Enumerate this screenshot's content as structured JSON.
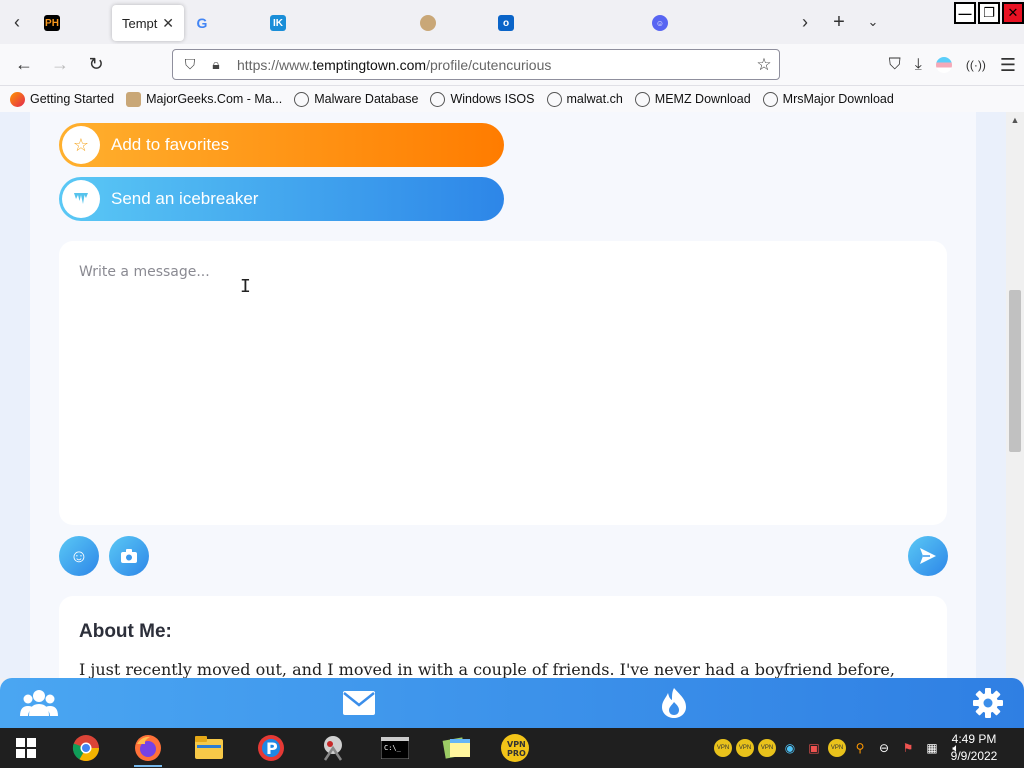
{
  "browser": {
    "tabs": [
      {
        "favicon_text": "PH",
        "title": "",
        "favicon_color": "#f7971d"
      },
      {
        "favicon_text": "",
        "title": "Temptin",
        "active": true
      },
      {
        "favicon_text": "G",
        "title": ""
      },
      {
        "favicon_text": "IK",
        "title": "",
        "favicon_color": "#1a8ed8"
      },
      {
        "favicon_text": "",
        "title": ""
      },
      {
        "favicon_text": "",
        "title": ""
      },
      {
        "favicon_text": "",
        "title": ""
      }
    ],
    "url": {
      "scheme": "https://www.",
      "host": "temptingtown.com",
      "path": "/profile/cutencurious"
    },
    "bookmarks": [
      "Getting Started",
      "MajorGeeks.Com - Ma...",
      "Malware Database",
      "Windows ISOS",
      "malwat.ch",
      "MEMZ Download",
      "MrsMajor Download"
    ]
  },
  "profile": {
    "favorites_label": "Add to favorites",
    "icebreaker_label": "Send an icebreaker",
    "message_placeholder": "Write a message...",
    "about_title": "About Me:",
    "about_text": "I just recently moved out, and I moved in with a couple of friends. I've never had a boyfriend before,"
  },
  "taskbar": {
    "time": "4:49 PM",
    "date": "9/9/2022"
  },
  "colors": {
    "favorites_gradient_start": "#ffb02e",
    "favorites_gradient_end": "#ff7c00",
    "blue_gradient_start": "#5ac8f5",
    "blue_gradient_end": "#2d86e8"
  }
}
